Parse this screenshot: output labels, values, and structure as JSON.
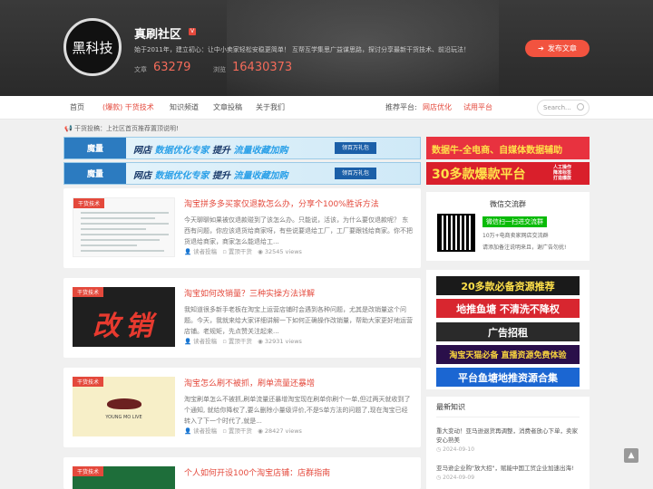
{
  "header": {
    "logo_text": "黑科技",
    "site_name": "真刷社区",
    "badge": "V",
    "slogan": "始于2011年，建立初心：让中小卖家轻松安稳更简单！ 互帮互学集思广益谋思路，探讨分享最新干货技术、前沿玩法！",
    "articles_label": "文章",
    "articles_count": "63279",
    "views_label": "浏览",
    "views_count": "16430373",
    "publish_label": "发布文章"
  },
  "nav": {
    "items": [
      "首页",
      "(爆款) 干货技术",
      "知识频道",
      "文章投稿",
      "关于我们"
    ],
    "platform_label": "推荐平台:",
    "platform_links": [
      "网店优化",
      "试用平台"
    ],
    "search_placeholder": "Search..."
  },
  "notice": "干货投稿：上社区首页推荐置顶说明!",
  "banners": [
    {
      "logo": "魔量",
      "text1": "网店",
      "text2": "数据优化专家",
      "text3": "提升",
      "text4": "流量收藏加购",
      "btn": "领百万礼包"
    },
    {
      "logo": "魔量",
      "text1": "网店",
      "text2": "数据优化专家",
      "text3": "提升",
      "text4": "流量收藏加购",
      "btn": "领百万礼包"
    }
  ],
  "side_banners": [
    {
      "text": "数据牛-全电商、自媒体数据辅助"
    },
    {
      "text": "30多款爆款平台",
      "tags": [
        "人工操作",
        "降准标签",
        "打造爆款"
      ]
    }
  ],
  "articles": [
    {
      "category": "干货技术",
      "title": "淘宝拼多多买家仅退款怎么办，分享个100%胜诉方法",
      "desc": "今天聊聊如果被仅退款碰到了该怎么办。只能说，活该，为什么要仅退款呢？ 东西有问题，你应该退货给商家呀，有些说要退给工厂，工厂要跟钱给商家。你不把货退给商家，商家怎么能退给工...",
      "author": "读者投稿",
      "section": "置顶干货",
      "views": "32545 views"
    },
    {
      "category": "干货技术",
      "title": "淘宝如何改销量？三种实操方法详解",
      "thumb_text": "改销",
      "desc": "我知道很多新手老板在淘宝上运营店铺时会遇到各种问题，尤其是改销量这个问题。今天，我就来给大家详细讲解一下如何正确操作改销量，帮助大家更好地运营店铺。老规矩，先点赞关注起来...",
      "author": "读者投稿",
      "section": "置顶干货",
      "views": "32931 views"
    },
    {
      "category": "干货技术",
      "title": "淘宝怎么刷不被抓，刷单流量还暴增",
      "thumb_text": "YOUNG MO LIVE",
      "desc": "淘宝刷单怎么不被抓,刷单流量还暴增淘宝现在刷单你刷个一单,但过两天就收到了个通知, 就给你降权了,要么删除小量级评价,不是S单方法的问题了,现在淘宝已经转入了下一个时代了,就是...",
      "author": "读者投稿",
      "section": "置顶干货",
      "views": "28427 views"
    },
    {
      "category": "干货技术",
      "title": "个人如何开设100个淘宝店铺：店群指南",
      "desc": "",
      "author": "",
      "section": "",
      "views": ""
    }
  ],
  "wechat": {
    "title": "微信交流群",
    "line1": "微信扫一扫进交流群",
    "line2": "10万+电商卖家网店交流群",
    "line3": "请添加备注说明来且，谢广告勿扰!"
  },
  "side_ads": [
    {
      "text": "20多款必备资源推荐",
      "color": "#1a1a1a",
      "fg": "#ffe14a"
    },
    {
      "text": "地推鱼塘 不清洗不降权",
      "color": "#d8262f",
      "fg": "#ffffff"
    },
    {
      "text": "广告招租",
      "color": "#2a2a2a",
      "fg": "#ffffff"
    },
    {
      "text": "淘宝天猫必备 直播资源免费体验",
      "color": "#2a0f4a",
      "fg": "#f7d23e"
    },
    {
      "text": "平台鱼塘地推资源合集",
      "color": "#1b66d2",
      "fg": "#ffffff"
    }
  ],
  "latest": {
    "title": "最新知识",
    "items": [
      {
        "text": "重大变动！亚马逊退货再调整，消费者放心下单，卖家安心熟美",
        "date": "2024-09-10"
      },
      {
        "text": "亚马逊企业购\"放大招\"，赋能中国工贸企业加速出海!",
        "date": "2024-09-09"
      }
    ]
  },
  "totop_icon": "▲"
}
